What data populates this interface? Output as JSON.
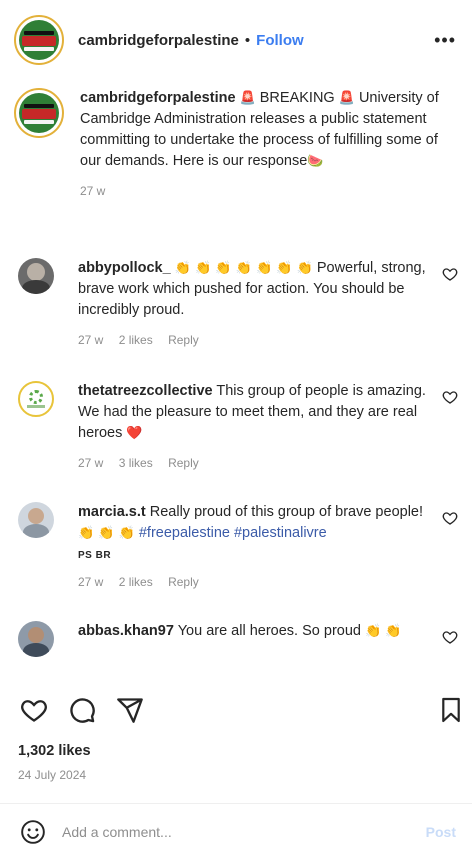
{
  "header": {
    "username": "cambridgeforpalestine",
    "separator": "•",
    "follow_label": "Follow",
    "more_label": "•••"
  },
  "caption": {
    "username": "cambridgeforpalestine",
    "alarm_glyph": "🚨",
    "breaking_label": "BREAKING",
    "text": "University of Cambridge Administration releases a public statement committing to undertake the process of fulfilling some of our demands. Here is our response",
    "watermelon_glyph": "🍉",
    "time": "27 w"
  },
  "comments": [
    {
      "username": "abbypollock_",
      "emojis": "👏 👏 👏 👏 👏 👏 👏",
      "text": "Powerful, strong, brave work which pushed for action. You should be incredibly proud.",
      "time": "27 w",
      "likes": "2 likes",
      "reply": "Reply"
    },
    {
      "username": "thetatreezcollective",
      "text": "This group of people is amazing. We had the pleasure to meet them, and they are real heroes",
      "heart_glyph": "❤️",
      "time": "27 w",
      "likes": "3 likes",
      "reply": "Reply"
    },
    {
      "username": "marcia.s.t",
      "text": "Really proud of this group of brave people!",
      "emojis": "👏 👏 👏",
      "tag1": "#freepalestine",
      "tag2": "#palestinalivre",
      "code": "PS BR",
      "time": "27 w",
      "likes": "2 likes",
      "reply": "Reply"
    },
    {
      "username": "abbas.khan97",
      "text": "You are all heroes. So proud",
      "emojis": "👏 👏"
    }
  ],
  "post": {
    "likes": "1,302 likes",
    "date": "24 July 2024"
  },
  "add_comment": {
    "placeholder": "Add a comment...",
    "post_label": "Post"
  },
  "colors": {
    "accent": "#3b7df0",
    "muted": "#8e8e8e",
    "text": "#262626",
    "hashtag": "#3b5ba8"
  },
  "icons": [
    "like-icon",
    "comment-icon",
    "share-icon",
    "save-icon",
    "emoji-icon",
    "more-icon",
    "comment-like-icon"
  ]
}
